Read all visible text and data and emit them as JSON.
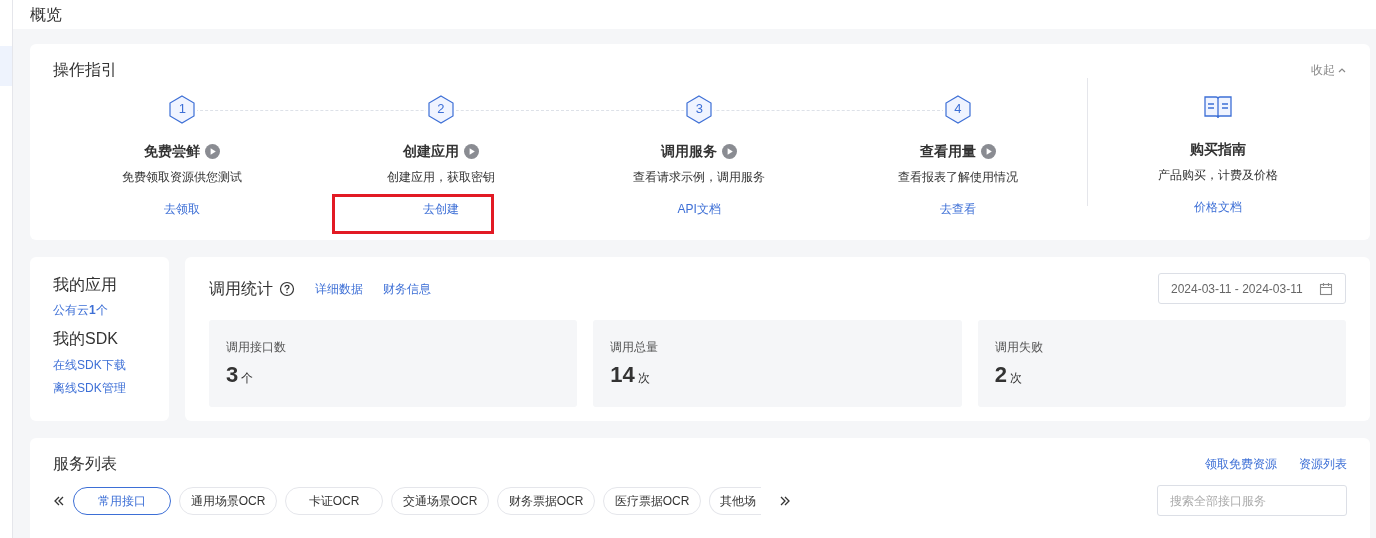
{
  "page_title": "概览",
  "guide": {
    "title": "操作指引",
    "collapse": "收起",
    "steps": [
      {
        "number": "1",
        "title": "免费尝鲜",
        "desc": "免费领取资源供您测试",
        "link": "去领取",
        "highlighted": false
      },
      {
        "number": "2",
        "title": "创建应用",
        "desc": "创建应用，获取密钥",
        "link": "去创建",
        "highlighted": true
      },
      {
        "number": "3",
        "title": "调用服务",
        "desc": "查看请求示例，调用服务",
        "link": "API文档",
        "highlighted": false
      },
      {
        "number": "4",
        "title": "查看用量",
        "desc": "查看报表了解使用情况",
        "link": "去查看",
        "highlighted": false
      }
    ],
    "purchase": {
      "title": "购买指南",
      "desc": "产品购买，计费及价格",
      "link": "价格文档"
    }
  },
  "my_apps": {
    "title": "我的应用",
    "apps_link": "公有云**1**个",
    "sdk_title": "我的SDK",
    "sdk_links": [
      "在线SDK下载",
      "离线SDK管理"
    ]
  },
  "stats": {
    "title": "调用统计",
    "links": [
      "详细数据",
      "财务信息"
    ],
    "date_range": "2024-03-11 - 2024-03-11",
    "cards": [
      {
        "label": "调用接口数",
        "value": "3",
        "unit": "个"
      },
      {
        "label": "调用总量",
        "value": "14",
        "unit": "次"
      },
      {
        "label": "调用失败",
        "value": "2",
        "unit": "次"
      }
    ]
  },
  "services": {
    "title": "服务列表",
    "links": [
      "领取免费资源",
      "资源列表"
    ],
    "tabs": [
      {
        "label": "常用接口",
        "selected": true
      },
      {
        "label": "通用场景OCR",
        "selected": false
      },
      {
        "label": "卡证OCR",
        "selected": false
      },
      {
        "label": "交通场景OCR",
        "selected": false
      },
      {
        "label": "财务票据OCR",
        "selected": false
      },
      {
        "label": "医疗票据OCR",
        "selected": false
      },
      {
        "label": "其他场",
        "selected": false
      }
    ],
    "search": {
      "placeholder": "搜索全部接口服务"
    }
  }
}
